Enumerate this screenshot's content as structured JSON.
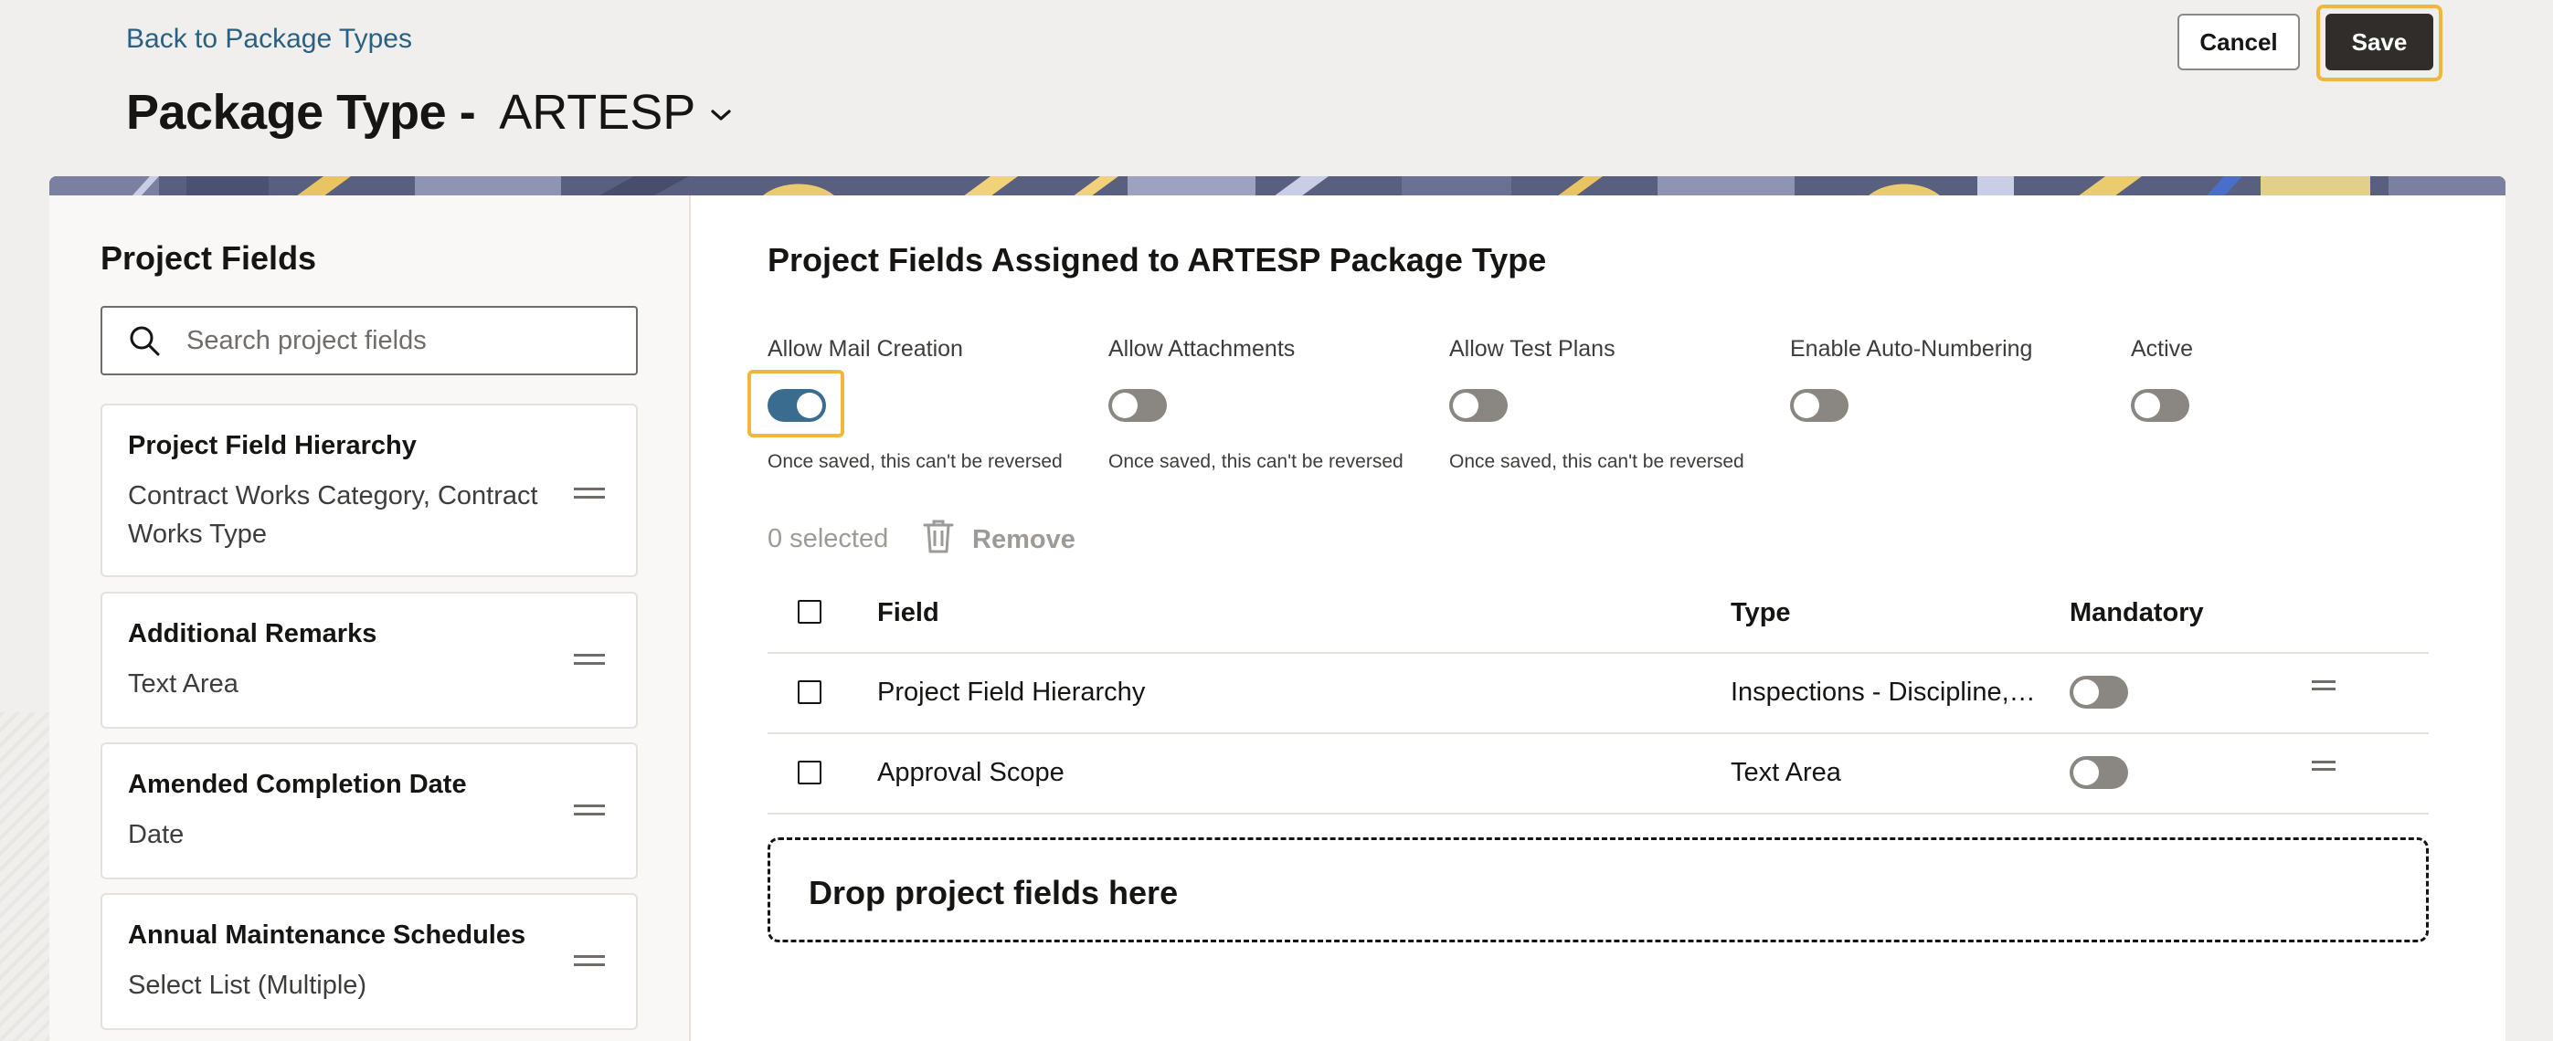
{
  "header": {
    "back_link": "Back to Package Types",
    "title_label": "Package Type -",
    "title_value": "ARTESP",
    "cancel_label": "Cancel",
    "save_label": "Save"
  },
  "left_panel": {
    "title": "Project Fields",
    "search_placeholder": "Search project fields",
    "fields": [
      {
        "name": "Project Field Hierarchy",
        "type": "Contract Works Category, Contract Works Type"
      },
      {
        "name": "Additional Remarks",
        "type": "Text Area"
      },
      {
        "name": "Amended Completion Date",
        "type": "Date"
      },
      {
        "name": "Annual Maintenance Schedules",
        "type": "Select List (Multiple)"
      }
    ]
  },
  "right_panel": {
    "title": "Project Fields Assigned to ARTESP Package Type",
    "options": [
      {
        "label": "Allow Mail Creation",
        "on": true,
        "note": "Once saved, this can't be reversed"
      },
      {
        "label": "Allow Attachments",
        "on": false,
        "note": "Once saved, this can't be reversed"
      },
      {
        "label": "Allow Test Plans",
        "on": false,
        "note": "Once saved, this can't be reversed"
      },
      {
        "label": "Enable Auto-Numbering",
        "on": false,
        "note": ""
      },
      {
        "label": "Active",
        "on": false,
        "note": ""
      }
    ],
    "selected_count": "0 selected",
    "remove_label": "Remove",
    "table": {
      "headers": {
        "field": "Field",
        "type": "Type",
        "mandatory": "Mandatory"
      },
      "rows": [
        {
          "field": "Project Field Hierarchy",
          "type": "Inspections - Discipline, Inspections - Subdiscipline",
          "mandatory": false
        },
        {
          "field": "Approval Scope",
          "type": "Text Area",
          "mandatory": false
        }
      ]
    },
    "drop_zone": "Drop project fields here"
  },
  "colors": {
    "accent_focus": "#f0b73a",
    "toggle_on": "#3a6c90",
    "link": "#2a6181",
    "primary_button": "#312d2a"
  }
}
